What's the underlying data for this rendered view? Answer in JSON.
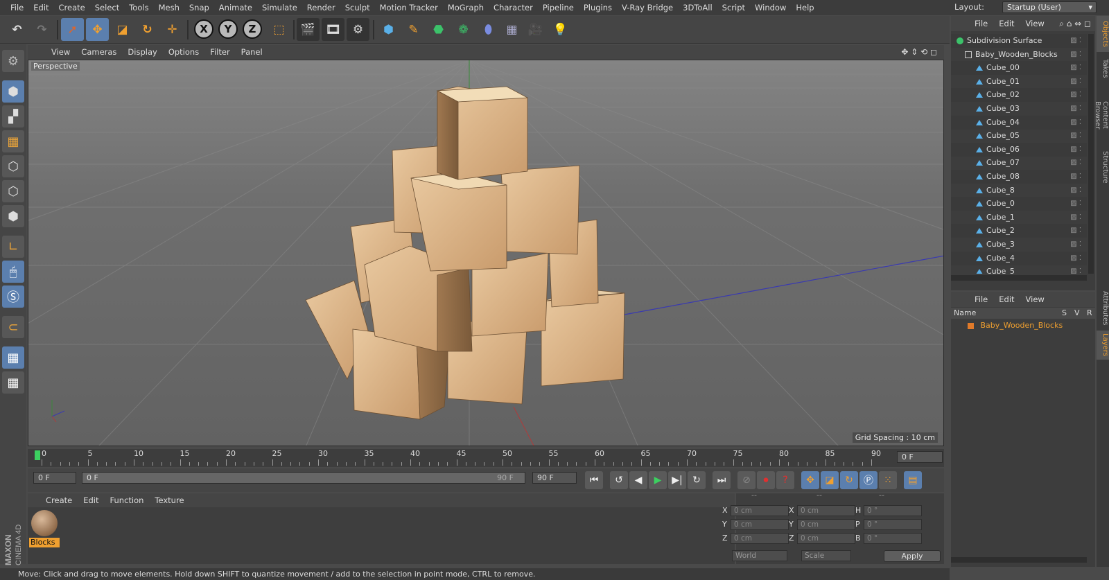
{
  "menubar": {
    "items": [
      "File",
      "Edit",
      "Create",
      "Select",
      "Tools",
      "Mesh",
      "Snap",
      "Animate",
      "Simulate",
      "Render",
      "Sculpt",
      "Motion Tracker",
      "MoGraph",
      "Character",
      "Pipeline",
      "Plugins",
      "V-Ray Bridge",
      "3DToAll",
      "Script",
      "Window",
      "Help"
    ],
    "layout_label": "Layout:",
    "layout_value": "Startup (User)"
  },
  "toolbar": {
    "x": "X",
    "y": "Y",
    "z": "Z"
  },
  "viewport": {
    "menu": [
      "View",
      "Cameras",
      "Display",
      "Options",
      "Filter",
      "Panel"
    ],
    "name": "Perspective",
    "grid_spacing": "Grid Spacing : 10 cm"
  },
  "timeline": {
    "ticks": [
      "0",
      "5",
      "10",
      "15",
      "20",
      "25",
      "30",
      "35",
      "40",
      "45",
      "50",
      "55",
      "60",
      "65",
      "70",
      "75",
      "80",
      "85",
      "90"
    ],
    "current_frame": "0 F",
    "start_field": "0 F",
    "range_start": "0 F",
    "range_end": "90 F",
    "end_field": "90 F"
  },
  "material_manager": {
    "menu": [
      "Create",
      "Edit",
      "Function",
      "Texture"
    ],
    "material_name": "Blocks"
  },
  "coordinates": {
    "header": [
      "--",
      "--",
      "--"
    ],
    "rows": [
      {
        "a": "X",
        "av": "0 cm",
        "b": "X",
        "bv": "0 cm",
        "c": "H",
        "cv": "0 °"
      },
      {
        "a": "Y",
        "av": "0 cm",
        "b": "Y",
        "bv": "0 cm",
        "c": "P",
        "cv": "0 °"
      },
      {
        "a": "Z",
        "av": "0 cm",
        "b": "Z",
        "bv": "0 cm",
        "c": "B",
        "cv": "0 °"
      }
    ],
    "mode1": "World",
    "mode2": "Scale",
    "apply": "Apply"
  },
  "objects": {
    "menu": [
      "File",
      "Edit",
      "View"
    ],
    "items": [
      "Subdivision Surface",
      "Baby_Wooden_Blocks",
      "Cube_00",
      "Cube_01",
      "Cube_02",
      "Cube_03",
      "Cube_04",
      "Cube_05",
      "Cube_06",
      "Cube_07",
      "Cube_08",
      "Cube_8",
      "Cube_0",
      "Cube_1",
      "Cube_2",
      "Cube_3",
      "Cube_4",
      "Cube_5"
    ]
  },
  "layers": {
    "menu": [
      "File",
      "Edit",
      "View"
    ],
    "col_name": "Name",
    "col_s": "S",
    "col_v": "V",
    "col_r": "R",
    "layer_name": "Baby_Wooden_Blocks",
    "layer_color": "#e07a2a"
  },
  "sidetabs": [
    "Objects",
    "Takes",
    "Content Browser",
    "Structure",
    "Attributes",
    "Layers"
  ],
  "statusbar": "Move: Click and drag to move elements. Hold down SHIFT to quantize movement / add to the selection in point mode, CTRL to remove.",
  "brand": "MAXON CINEMA 4D"
}
